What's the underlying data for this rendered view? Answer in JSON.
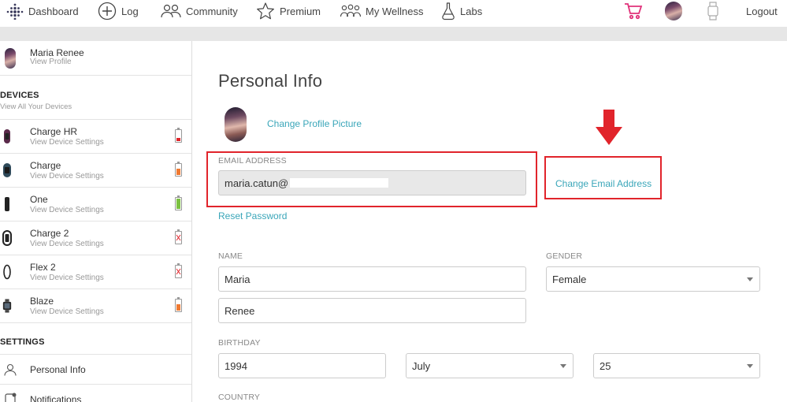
{
  "nav": {
    "dashboard": "Dashboard",
    "log": "Log",
    "community": "Community",
    "premium": "Premium",
    "wellness": "My Wellness",
    "labs": "Labs",
    "logout": "Logout"
  },
  "sidebar": {
    "user_name": "Maria Renee",
    "view_profile": "View Profile",
    "devices_heading": "DEVICES",
    "view_all_devices": "View All Your Devices",
    "devices": [
      {
        "name": "Charge HR",
        "sub": "View Device Settings",
        "battery": "low",
        "battery_color": "#e1242b"
      },
      {
        "name": "Charge",
        "sub": "View Device Settings",
        "battery": "medium",
        "battery_color": "#f07a32"
      },
      {
        "name": "One",
        "sub": "View Device Settings",
        "battery": "full",
        "battery_color": "#7cc142"
      },
      {
        "name": "Charge 2",
        "sub": "View Device Settings",
        "battery": "unknown",
        "battery_color": "#e1242b"
      },
      {
        "name": "Flex 2",
        "sub": "View Device Settings",
        "battery": "unknown",
        "battery_color": "#e1242b"
      },
      {
        "name": "Blaze",
        "sub": "View Device Settings",
        "battery": "medium",
        "battery_color": "#f07a32"
      }
    ],
    "settings_heading": "SETTINGS",
    "settings": [
      {
        "label": "Personal Info"
      },
      {
        "label": "Notifications"
      }
    ]
  },
  "main": {
    "title": "Personal Info",
    "change_picture": "Change Profile Picture",
    "email_label": "EMAIL ADDRESS",
    "email_value": "maria.catun@",
    "change_email": "Change Email Address",
    "reset_password": "Reset Password",
    "name_label": "NAME",
    "first_name": "Maria",
    "last_name": "Renee",
    "gender_label": "GENDER",
    "gender_value": "Female",
    "birthday_label": "BIRTHDAY",
    "birth_year": "1994",
    "birth_month": "July",
    "birth_day": "25",
    "country_label": "COUNTRY"
  },
  "colors": {
    "link": "#3aa6b9",
    "annotation": "#e1242b",
    "cart": "#e0327a"
  }
}
